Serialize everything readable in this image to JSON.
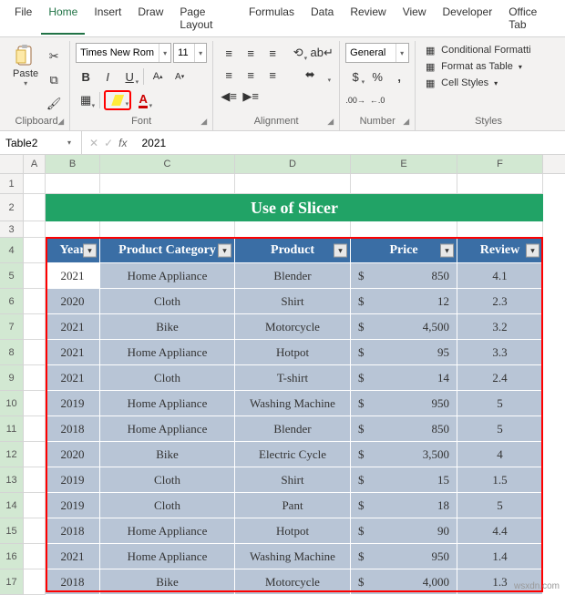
{
  "menu": {
    "file": "File",
    "home": "Home",
    "insert": "Insert",
    "draw": "Draw",
    "page": "Page Layout",
    "formulas": "Formulas",
    "data": "Data",
    "review": "Review",
    "view": "View",
    "developer": "Developer",
    "officetab": "Office Tab"
  },
  "ribbon": {
    "clipboard": {
      "paste": "Paste",
      "label": "Clipboard"
    },
    "font": {
      "name": "Times New Rom",
      "size": "11",
      "label": "Font"
    },
    "align": {
      "label": "Alignment"
    },
    "number": {
      "format": "General",
      "label": "Number"
    },
    "styles": {
      "cond": "Conditional Formatti",
      "table": "Format as Table",
      "cell": "Cell Styles",
      "label": "Styles"
    }
  },
  "namebox": "Table2",
  "formula": "2021",
  "cols": [
    "A",
    "B",
    "C",
    "D",
    "E",
    "F"
  ],
  "banner": "Use of Slicer",
  "headers": [
    "Year",
    "Product Category",
    "Product",
    "Price",
    "Review"
  ],
  "data": [
    {
      "year": "2021",
      "cat": "Home Appliance",
      "prod": "Blender",
      "price": "850",
      "review": "4.1"
    },
    {
      "year": "2020",
      "cat": "Cloth",
      "prod": "Shirt",
      "price": "12",
      "review": "2.3"
    },
    {
      "year": "2021",
      "cat": "Bike",
      "prod": "Motorcycle",
      "price": "4,500",
      "review": "3.2"
    },
    {
      "year": "2021",
      "cat": "Home Appliance",
      "prod": "Hotpot",
      "price": "95",
      "review": "3.3"
    },
    {
      "year": "2021",
      "cat": "Cloth",
      "prod": "T-shirt",
      "price": "14",
      "review": "2.4"
    },
    {
      "year": "2019",
      "cat": "Home Appliance",
      "prod": "Washing Machine",
      "price": "950",
      "review": "5"
    },
    {
      "year": "2018",
      "cat": "Home Appliance",
      "prod": "Blender",
      "price": "850",
      "review": "5"
    },
    {
      "year": "2020",
      "cat": "Bike",
      "prod": "Electric Cycle",
      "price": "3,500",
      "review": "4"
    },
    {
      "year": "2019",
      "cat": "Cloth",
      "prod": "Shirt",
      "price": "15",
      "review": "1.5"
    },
    {
      "year": "2019",
      "cat": "Cloth",
      "prod": "Pant",
      "price": "18",
      "review": "5"
    },
    {
      "year": "2018",
      "cat": "Home Appliance",
      "prod": "Hotpot",
      "price": "90",
      "review": "4.4"
    },
    {
      "year": "2021",
      "cat": "Home Appliance",
      "prod": "Washing Machine",
      "price": "950",
      "review": "1.4"
    },
    {
      "year": "2018",
      "cat": "Bike",
      "prod": "Motorcycle",
      "price": "4,000",
      "review": "1.3"
    }
  ],
  "watermark": "wsxdn.com"
}
